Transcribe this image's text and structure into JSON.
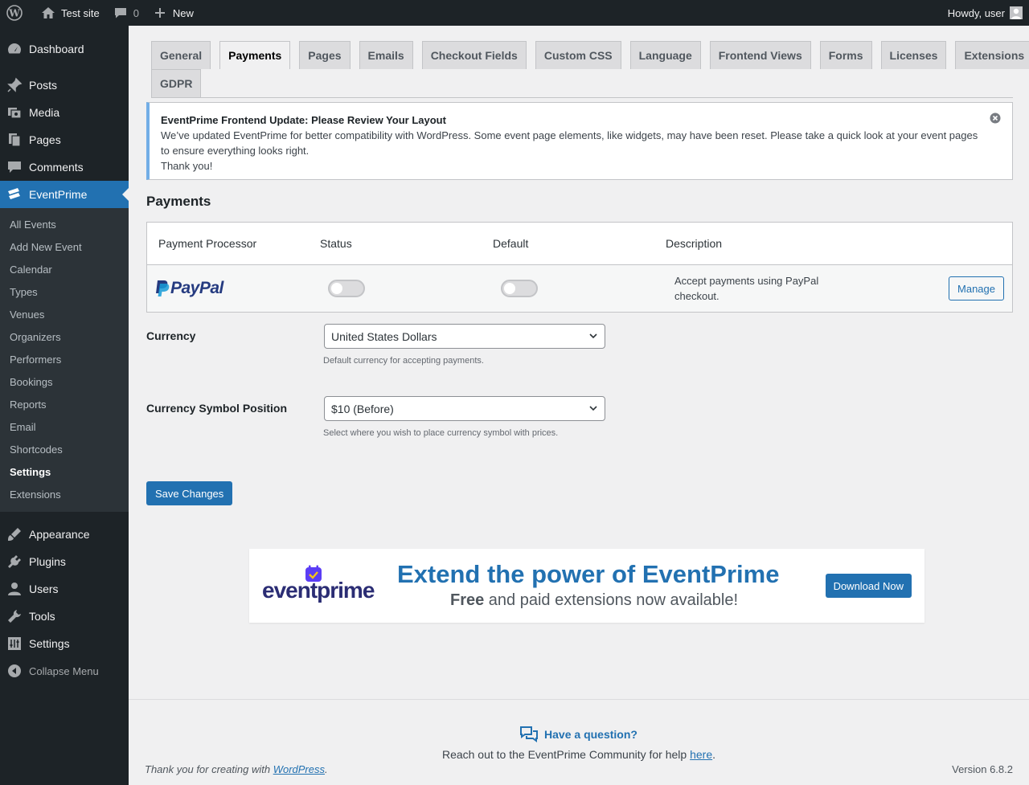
{
  "adminbar": {
    "site_name": "Test site",
    "comments_count": "0",
    "new_label": "New",
    "howdy": "Howdy, user"
  },
  "sidebar": {
    "top_items": [
      {
        "label": "Dashboard",
        "icon": "dashboard-icon"
      },
      {
        "label": "Posts",
        "icon": "pin-icon"
      },
      {
        "label": "Media",
        "icon": "media-icon"
      },
      {
        "label": "Pages",
        "icon": "pages-icon"
      },
      {
        "label": "Comments",
        "icon": "comment-icon"
      },
      {
        "label": "EventPrime",
        "icon": "eventprime-icon"
      }
    ],
    "submenu": [
      "All Events",
      "Add New Event",
      "Calendar",
      "Types",
      "Venues",
      "Organizers",
      "Performers",
      "Bookings",
      "Reports",
      "Email",
      "Shortcodes",
      "Settings",
      "Extensions"
    ],
    "bottom_items": [
      {
        "label": "Appearance",
        "icon": "brush-icon"
      },
      {
        "label": "Plugins",
        "icon": "plug-icon"
      },
      {
        "label": "Users",
        "icon": "users-icon"
      },
      {
        "label": "Tools",
        "icon": "wrench-icon"
      },
      {
        "label": "Settings",
        "icon": "settings-icon"
      }
    ],
    "collapse_label": "Collapse Menu"
  },
  "tabs": [
    "General",
    "Payments",
    "Pages",
    "Emails",
    "Checkout Fields",
    "Custom CSS",
    "Language",
    "Frontend Views",
    "Forms",
    "Licenses",
    "Extensions",
    "GDPR"
  ],
  "notice": {
    "title": "EventPrime Frontend Update: Please Review Your Layout",
    "body": "We’ve updated EventPrime for better compatibility with WordPress. Some event page elements, like widgets, may have been reset. Please take a quick look at your event pages to ensure everything looks right.",
    "thanks": "Thank you!"
  },
  "payments": {
    "title": "Payments",
    "headers": [
      "Payment Processor",
      "Status",
      "Default",
      "Description"
    ],
    "row": {
      "logo_text": "PayPal",
      "description": "Accept payments using PayPal checkout.",
      "manage_label": "Manage"
    }
  },
  "currency": {
    "label": "Currency",
    "value": "United States Dollars",
    "desc": "Default currency for accepting payments."
  },
  "symbol_position": {
    "label": "Currency Symbol Position",
    "value": "$10 (Before)",
    "desc": "Select where you wish to place currency symbol with prices."
  },
  "save_label": "Save Changes",
  "banner": {
    "logo_text": "eventprime",
    "headline": "Extend the power of EventPrime",
    "sub_bold": "Free",
    "sub_rest": " and paid extensions now available!",
    "download_label": "Download Now"
  },
  "footer": {
    "help_title": "Have a question?",
    "help_text": "Reach out to the EventPrime Community for help ",
    "help_link": "here",
    "thanks_prefix": "Thank you for creating with ",
    "thanks_link": "WordPress",
    "version": "Version 6.8.2"
  },
  "colors": {
    "accent": "#2271b1",
    "adminbar": "#1d2327",
    "notice_border": "#72aee6"
  }
}
